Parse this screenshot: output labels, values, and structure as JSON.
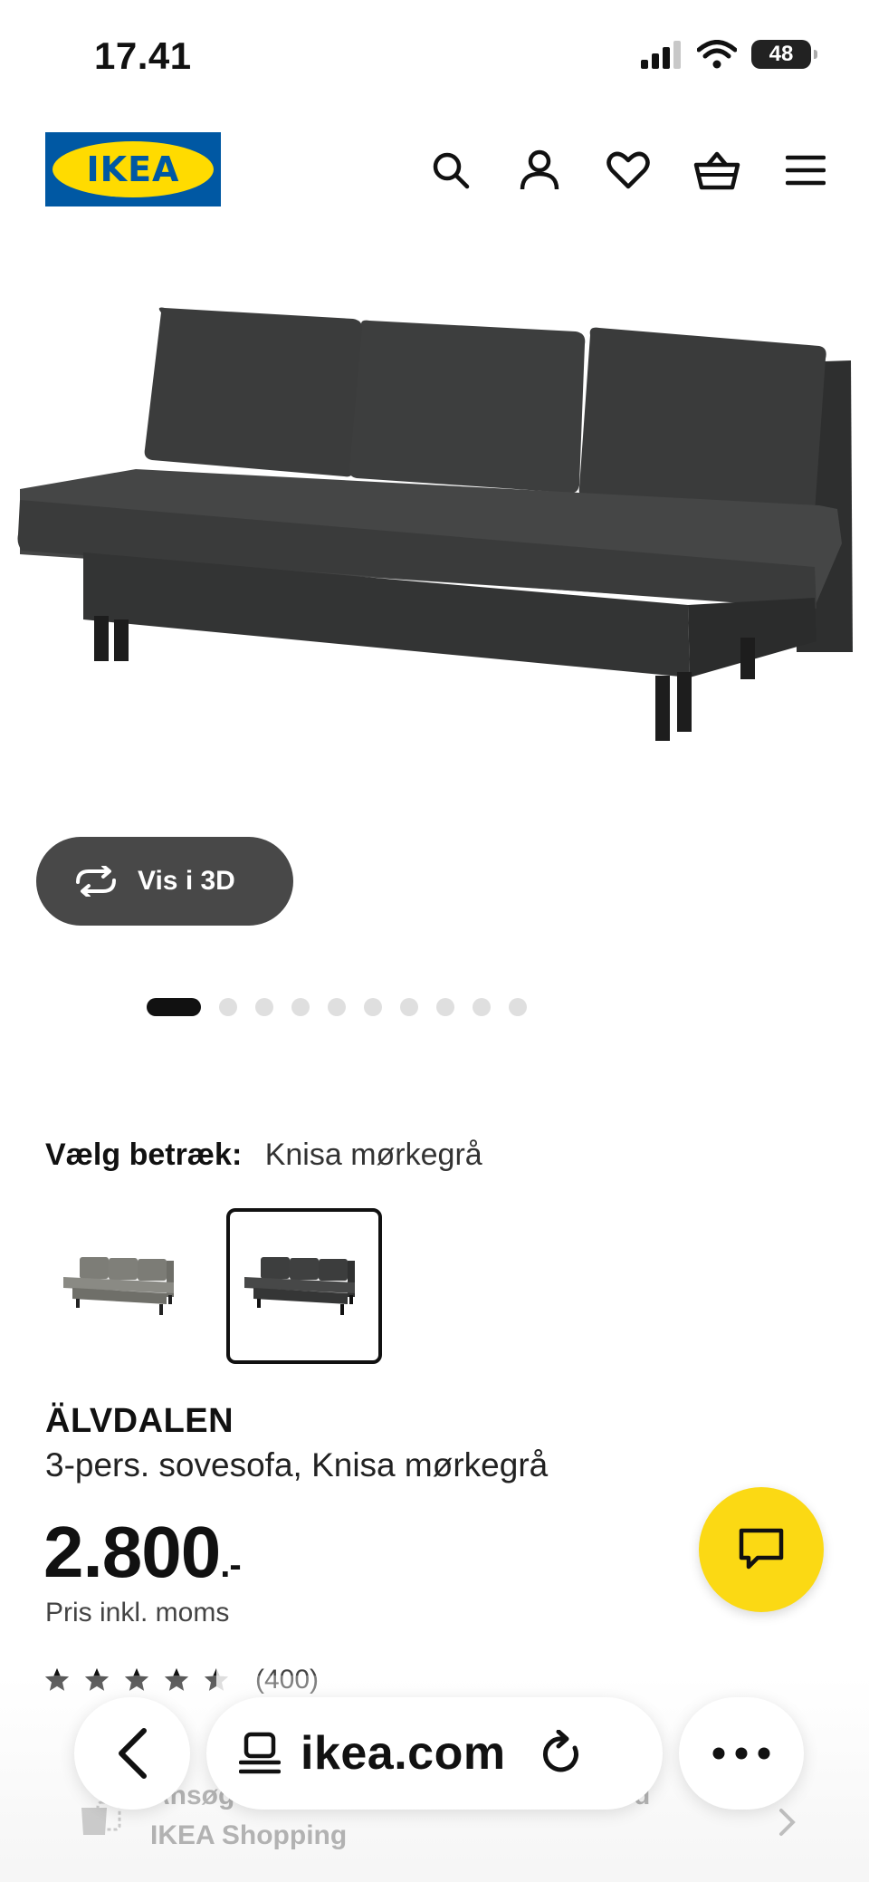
{
  "status_bar": {
    "time": "17.41",
    "battery": "48"
  },
  "header": {
    "logo_text": "IKEA"
  },
  "product": {
    "view_3d_label": "Vis i 3D",
    "gallery_total": 10,
    "gallery_active_index": 0,
    "cover_label": "Vælg betræk:",
    "cover_value": "Knisa mørkegrå",
    "swatches": [
      {
        "name": "Knisa grå",
        "color": "#7a7a74",
        "selected": false
      },
      {
        "name": "Knisa mørkegrå",
        "color": "#3a3b3b",
        "selected": true
      }
    ],
    "name": "ÄLVDALEN",
    "description": "3-pers. sovesofa, Knisa mørkegrå",
    "price": "2.800",
    "price_suffix": ".-",
    "price_note": "Pris inkl. moms",
    "rating": {
      "stars": 4.5,
      "max": 5,
      "count": "(400)"
    }
  },
  "promo": {
    "title": "Ansøg",
    "title_end": "d",
    "subtitle": "IKEA Shopping"
  },
  "browser": {
    "url": "ikea.com"
  },
  "colors": {
    "brand_blue": "#0058a3",
    "brand_yellow": "#ffdb00",
    "chat_yellow": "#fbd914",
    "sofa": "#3a3b3b"
  }
}
